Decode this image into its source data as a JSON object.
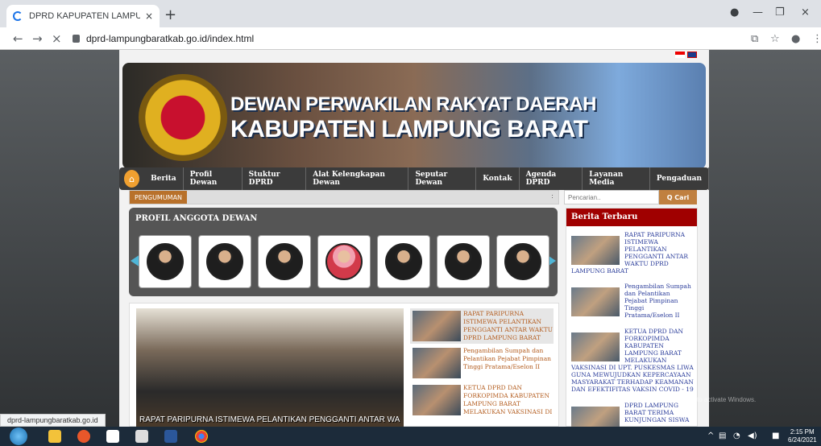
{
  "browser": {
    "tab_title": "DPRD KAPUPATEN LAMPUNG BA",
    "tab_close": "×",
    "new_tab": "+",
    "url": "dprd-lampungbaratkab.go.id/index.html",
    "status_url": "dprd-lampungbaratkab.go.id",
    "back": "←",
    "forward": "→",
    "stop": "×",
    "minimize": "—",
    "maximize": "❐",
    "close": "×"
  },
  "banner": {
    "line1": "DEWAN PERWAKILAN RAKYAT DAERAH",
    "line2": "KABUPATEN LAMPUNG BARAT"
  },
  "menu": {
    "items": [
      "Berita",
      "Profil Dewan",
      "Stuktur DPRD",
      "Alat Kelengkapan Dewan",
      "Seputar Dewan",
      "Kontak",
      "Agenda DPRD",
      "Layanan Media",
      "Pengaduan"
    ]
  },
  "announcement": {
    "label": "PENGUMUMAN",
    "close": ":"
  },
  "search": {
    "placeholder": "Pencarian..",
    "button": "Q  Cari"
  },
  "profil": {
    "title": "PROFIL ANGGOTA DEWAN"
  },
  "news": {
    "main_caption": "RAPAT PARIPURNA ISTIMEWA PELANTIKAN PENGGANTI ANTAR WAKTU",
    "items": [
      "RAPAT PARIPURNA ISTIMEWA PELANTIKAN PENGGANTI ANTAR WAKTU DPRD LAMPUNG BARAT",
      "Pengambilan Sumpah dan Pelantikan Pejabat Pimpinan Tinggi Pratama/Eselon II",
      "KETUA DPRD DAN FORKOPIMDA KABUPATEN LAMPUNG BARAT MELAKUKAN VAKSINASI DI"
    ]
  },
  "sidebar": {
    "title": "Berita Terbaru",
    "items": [
      {
        "text": "RAPAT PARIPURNA ISTIMEWA PELANTIKAN PENGGANTI ANTAR WAKTU DPRD",
        "tail": "LAMPUNG BARAT"
      },
      {
        "text": "Pengambilan Sumpah dan Pelantikan Pejabat Pimpinan Tinggi Pratama/Eselon II",
        "tail": ""
      },
      {
        "text": "KETUA DPRD DAN FORKOPIMDA KABUPATEN LAMPUNG BARAT MELAKUKAN",
        "tail": "VAKSINASI DI UPT. PUSKESMAS LIWA GUNA MEWUJUDKAN KEPERCAYAAN MASYARAKAT TERHADAP KEAMANAN DAN EFEKTIFITAS VAKSIN COVID - 19"
      },
      {
        "text": "DPRD LAMPUNG BARAT TERIMA KUNJUNGAN SISWA",
        "tail": ""
      }
    ]
  },
  "watermark": "Go to Settings to activate Windows.",
  "taskbar": {
    "time": "2:15 PM",
    "date": "6/24/2021"
  }
}
